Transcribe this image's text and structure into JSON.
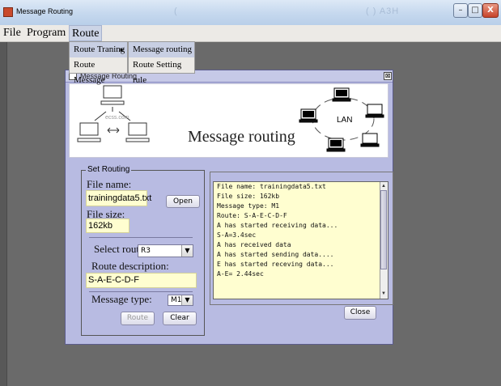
{
  "window": {
    "title": "Message Routing",
    "ghost_text": [
      "(",
      "( ) A3H"
    ],
    "controls": {
      "minimize": "–",
      "maximize": "□",
      "close": "X"
    }
  },
  "menubar": {
    "items": [
      "File",
      "Program",
      "Route"
    ]
  },
  "route_menu": {
    "items": [
      "Route Traning",
      "Route Message"
    ],
    "submenu_arrow": "▸",
    "submenu": [
      "Message routing",
      "Route Setting rule"
    ]
  },
  "frame": {
    "title": "Message Routing",
    "close_glyph": "⊠",
    "banner_title": "Message routing",
    "banner_watermark": "ecss.com",
    "lan_label": "LAN"
  },
  "routing": {
    "legend": "Set Routing",
    "file_name_label": "File name:",
    "file_name_value": "trainingdata5.txt",
    "open_button": "Open",
    "file_size_label": "File size:",
    "file_size_value": "162kb",
    "select_route_label": "Select route",
    "select_route_value": "R3",
    "route_description_label": "Route description:",
    "route_description_value": "S-A-E-C-D-F",
    "message_type_label": "Message type:",
    "message_type_value": "M1",
    "route_button": "Route",
    "clear_button": "Clear"
  },
  "log": {
    "lines": [
      "File name: trainingdata5.txt",
      "File size: 162kb",
      "Message type: M1",
      "Route: S-A-E-C-D-F",
      "A has started receiving data...",
      "S-A=3.4sec",
      "A has received data",
      "A has started sending data....",
      "E has started receving data...",
      "A-E= 2.44sec"
    ]
  },
  "close_button": "Close",
  "dropdown_arrow": "▼",
  "colors": {
    "frame_bg": "#b8bbe2",
    "field_bg": "#fffed0",
    "desktop": "#6a6a6a"
  }
}
